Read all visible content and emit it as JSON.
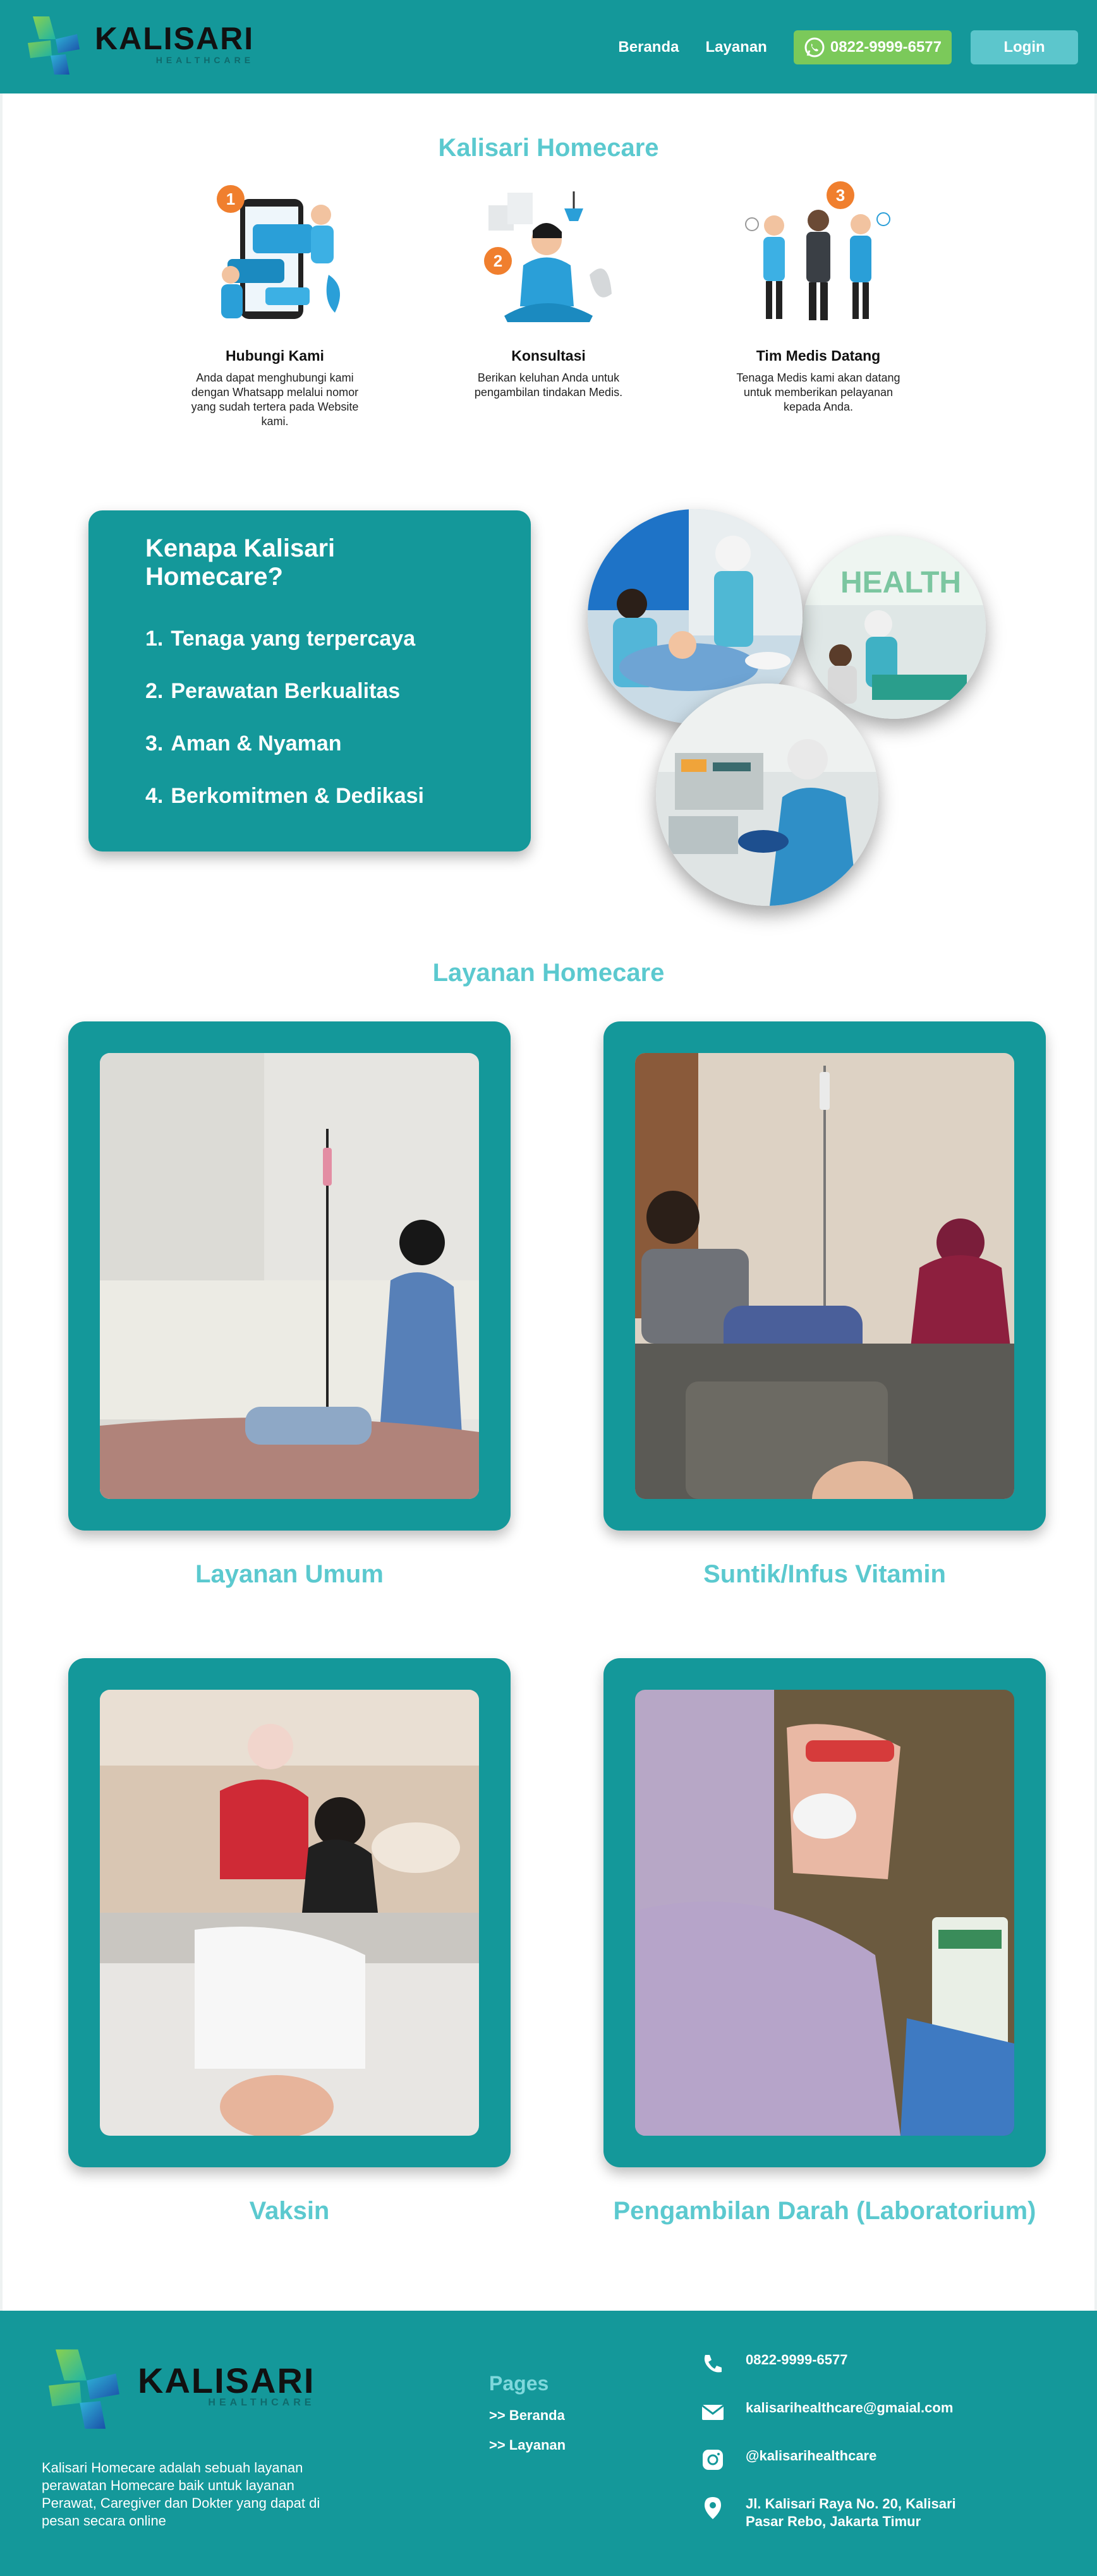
{
  "header": {
    "brand_name": "KALISARI",
    "brand_sub": "HEALTHCARE",
    "nav": [
      "Beranda",
      "Layanan"
    ],
    "whatsapp_label": "0822-9999-6577",
    "login_label": "Login"
  },
  "steps_section": {
    "title": "Kalisari Homecare",
    "steps": [
      {
        "badge": "1",
        "title": "Hubungi Kami",
        "desc": "Anda dapat menghubungi kami dengan Whatsapp melalui nomor yang sudah tertera pada Website kami."
      },
      {
        "badge": "2",
        "title": "Konsultasi",
        "desc": "Berikan keluhan Anda untuk pengambilan tindakan Medis."
      },
      {
        "badge": "3",
        "title": "Tim Medis Datang",
        "desc": "Tenaga Medis kami akan datang untuk memberikan pelayanan kepada Anda."
      }
    ]
  },
  "why": {
    "title": "Kenapa Kalisari Homecare?",
    "items": [
      {
        "num": "1.",
        "text": "Tenaga yang terpercaya"
      },
      {
        "num": "2.",
        "text": "Perawatan Berkualitas"
      },
      {
        "num": "3.",
        "text": "Aman & Nyaman"
      },
      {
        "num": "4.",
        "text": "Berkomitmen & Dedikasi"
      }
    ],
    "photo_sign_text": "HEALTH"
  },
  "services": {
    "title": "Layanan Homecare",
    "items": [
      "Layanan Umum",
      "Suntik/Infus Vitamin",
      "Vaksin",
      "Pengambilan Darah (Laboratorium)"
    ]
  },
  "footer": {
    "brand_name": "KALISARI",
    "brand_sub": "HEALTHCARE",
    "about": "Kalisari Homecare adalah sebuah layanan perawatan Homecare baik untuk layanan Perawat, Caregiver dan Dokter yang dapat di pesan secara online",
    "pages_title": "Pages",
    "pages": [
      ">> Beranda",
      ">> Layanan"
    ],
    "contacts": {
      "phone": "0822-9999-6577",
      "email": "kalisarihealthcare@gmaial.com",
      "instagram": "@kalisarihealthcare",
      "address": "Jl. Kalisari Raya No. 20, Kalisari Pasar Rebo, Jakarta Timur"
    }
  },
  "colors": {
    "primary": "#14989a",
    "accent_title": "#5bc9cf",
    "whatsapp": "#7bc95a",
    "login": "#5cc6cc",
    "badge": "#f07f2e"
  }
}
